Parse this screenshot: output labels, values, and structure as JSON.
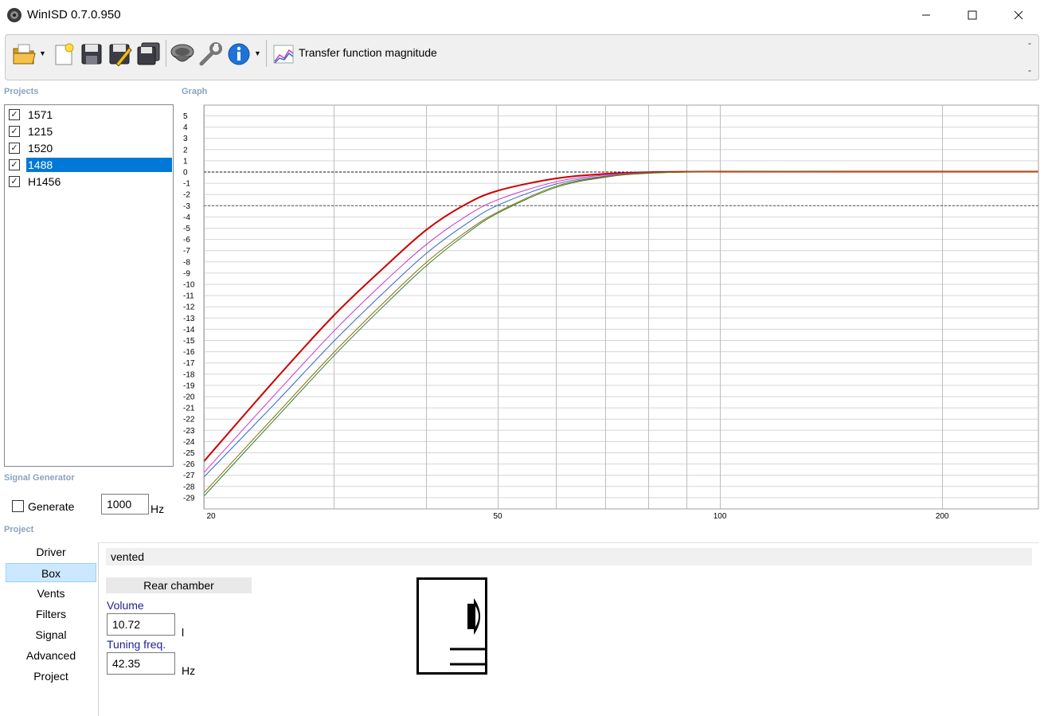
{
  "window": {
    "title": "WinISD 0.7.0.950"
  },
  "toolbar": {
    "tool_label": "Transfer function magnitude",
    "dash_top": "-",
    "dash_bottom": "-"
  },
  "sections": {
    "projects": "Projects",
    "graph": "Graph",
    "signal_generator": "Signal Generator",
    "project": "Project"
  },
  "projects": [
    {
      "name": "1571",
      "checked": true,
      "selected": false
    },
    {
      "name": "1215",
      "checked": true,
      "selected": false
    },
    {
      "name": "1520",
      "checked": true,
      "selected": false
    },
    {
      "name": "1488",
      "checked": true,
      "selected": true
    },
    {
      "name": "H1456",
      "checked": true,
      "selected": false
    }
  ],
  "signal_generator": {
    "generate_label": "Generate",
    "frequency": "1000",
    "unit": "Hz"
  },
  "nav": [
    "Driver",
    "Box",
    "Vents",
    "Filters",
    "Signal",
    "Advanced",
    "Project"
  ],
  "nav_active": "Box",
  "box": {
    "type": "vented",
    "chamber": "Rear chamber",
    "volume_label": "Volume",
    "volume_value": "10.72",
    "volume_unit": "l",
    "tuning_label": "Tuning freq.",
    "tuning_value": "42.35",
    "tuning_unit": "Hz"
  },
  "chart_data": {
    "type": "line",
    "title": "",
    "xlabel": "",
    "ylabel": "",
    "xscale": "log",
    "xlim": [
      20,
      270
    ],
    "ylim": [
      -30,
      6
    ],
    "x_tick_labels": [
      "20",
      "50",
      "100",
      "200"
    ],
    "y_tick_labels": [
      "5",
      "4",
      "3",
      "2",
      "1",
      "0",
      "-1",
      "-2",
      "-3",
      "-4",
      "-5",
      "-6",
      "-7",
      "-8",
      "-9",
      "-10",
      "-11",
      "-12",
      "-13",
      "-14",
      "-15",
      "-16",
      "-17",
      "-18",
      "-19",
      "-20",
      "-21",
      "-22",
      "-23",
      "-24",
      "-25",
      "-26",
      "-27",
      "-28",
      "-29"
    ],
    "reference_lines": [
      0,
      -3
    ],
    "grid": true,
    "series": [
      {
        "color": "#cc0000",
        "x": [
          20,
          25,
          30,
          35,
          40,
          45,
          50,
          60,
          70,
          80,
          100,
          150,
          200,
          270
        ],
        "values": [
          -25.8,
          -18.5,
          -12.8,
          -8.6,
          -5.2,
          -3.0,
          -1.7,
          -0.6,
          -0.2,
          -0.05,
          0,
          0,
          0,
          0
        ]
      },
      {
        "color": "#cc33cc",
        "x": [
          20,
          25,
          30,
          35,
          40,
          45,
          50,
          60,
          70,
          80,
          100,
          150,
          200,
          270
        ],
        "values": [
          -26.8,
          -19.8,
          -14.2,
          -9.9,
          -6.5,
          -4.1,
          -2.5,
          -0.9,
          -0.3,
          -0.1,
          0,
          0,
          0,
          0
        ]
      },
      {
        "color": "#3366cc",
        "x": [
          20,
          25,
          30,
          35,
          40,
          45,
          50,
          60,
          70,
          80,
          100,
          150,
          200,
          270
        ],
        "values": [
          -27.2,
          -20.6,
          -15.1,
          -10.8,
          -7.3,
          -4.8,
          -3.0,
          -1.1,
          -0.4,
          -0.1,
          0,
          0,
          0,
          0
        ]
      },
      {
        "color": "#2e7d32",
        "x": [
          20,
          25,
          30,
          35,
          40,
          45,
          50,
          60,
          70,
          80,
          100,
          150,
          200,
          270
        ],
        "values": [
          -28.9,
          -22.0,
          -16.4,
          -12.0,
          -8.4,
          -5.7,
          -3.7,
          -1.4,
          -0.5,
          -0.15,
          0,
          0,
          0,
          0
        ]
      },
      {
        "color": "#8a6d00",
        "x": [
          20,
          25,
          30,
          35,
          40,
          45,
          50,
          60,
          70,
          80,
          100,
          150,
          200,
          270
        ],
        "values": [
          -28.6,
          -21.7,
          -16.1,
          -11.7,
          -8.1,
          -5.5,
          -3.6,
          -1.3,
          -0.45,
          -0.12,
          0,
          0,
          0,
          0
        ]
      }
    ]
  }
}
